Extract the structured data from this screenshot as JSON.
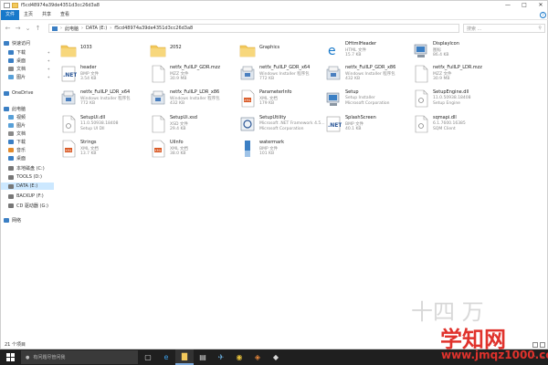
{
  "window": {
    "title": "f5cd48974a39de4351d3cc26d3a8",
    "controls": [
      "—",
      "□",
      "✕"
    ]
  },
  "ribbon": {
    "tabs": [
      "文件",
      "主页",
      "共享",
      "查看"
    ]
  },
  "address": {
    "path": [
      "此电脑",
      "DATA (E:)",
      "f5cd48974a39de4351d3cc26d3a8"
    ],
    "search_placeholder": "搜索 ..."
  },
  "sidebar": {
    "items": [
      {
        "label": "快速访问",
        "icon": "star-icon",
        "pinned": false
      },
      {
        "label": "下载",
        "icon": "download-icon",
        "pinned": true
      },
      {
        "label": "桌面",
        "icon": "desktop-icon",
        "pinned": true
      },
      {
        "label": "文档",
        "icon": "document-icon",
        "pinned": true
      },
      {
        "label": "图片",
        "icon": "picture-icon",
        "pinned": true
      },
      {
        "label": "OneDrive",
        "icon": "cloud-icon",
        "pinned": false
      },
      {
        "label": "此电脑",
        "icon": "computer-icon",
        "pinned": false
      },
      {
        "label": "视频",
        "icon": "video-icon",
        "pinned": false
      },
      {
        "label": "图片",
        "icon": "picture-icon",
        "pinned": false
      },
      {
        "label": "文档",
        "icon": "document-icon",
        "pinned": false
      },
      {
        "label": "下载",
        "icon": "download-icon",
        "pinned": false
      },
      {
        "label": "音乐",
        "icon": "music-icon",
        "pinned": false
      },
      {
        "label": "桌面",
        "icon": "desktop-icon",
        "pinned": false
      },
      {
        "label": "本地磁盘 (C:)",
        "icon": "drive-icon",
        "pinned": false
      },
      {
        "label": "TOOLS (D:)",
        "icon": "drive-icon",
        "pinned": false
      },
      {
        "label": "DATA (E:)",
        "icon": "drive-icon",
        "pinned": false,
        "selected": true
      },
      {
        "label": "BACKUP (F:)",
        "icon": "drive-icon",
        "pinned": false
      },
      {
        "label": "CD 驱动器 (G:)",
        "icon": "cd-drive-icon",
        "pinned": false
      },
      {
        "label": "网络",
        "icon": "network-icon",
        "pinned": false
      }
    ]
  },
  "files": [
    {
      "name": "1033",
      "type": "",
      "size": "",
      "icon": "folder-icon"
    },
    {
      "name": "2052",
      "type": "",
      "size": "",
      "icon": "folder-icon"
    },
    {
      "name": "Graphics",
      "type": "",
      "size": "",
      "icon": "folder-icon"
    },
    {
      "name": "DHtmlHeader",
      "type": "HTML 文件",
      "size": "15.7 KB",
      "icon": "html-icon"
    },
    {
      "name": "DisplayIcon",
      "type": "图标",
      "size": "86.4 KB",
      "icon": "setup-icon"
    },
    {
      "name": "header",
      "type": "BMP 文件",
      "size": "3.54 KB",
      "icon": "dotnet-icon"
    },
    {
      "name": "netfx_FullLP_GDR.mzz",
      "type": "MZZ 文件",
      "size": "30.9 MB",
      "icon": "blank-file-icon"
    },
    {
      "name": "netfx_FullLP_GDR_x64",
      "type": "Windows Installer 程序包",
      "size": "772 KB",
      "icon": "installer-icon"
    },
    {
      "name": "netfx_FullLP_GDR_x86",
      "type": "Windows Installer 程序包",
      "size": "432 KB",
      "icon": "installer-icon"
    },
    {
      "name": "netfx_FullLP_LDR.mzz",
      "type": "MZZ 文件",
      "size": "30.9 MB",
      "icon": "blank-file-icon"
    },
    {
      "name": "netfx_FullLP_LDR_x64",
      "type": "Windows Installer 程序包",
      "size": "772 KB",
      "icon": "installer-icon"
    },
    {
      "name": "netfx_FullLP_LDR_x86",
      "type": "Windows Installer 程序包",
      "size": "432 KB",
      "icon": "installer-icon"
    },
    {
      "name": "ParameterInfo",
      "type": "XML 文档",
      "size": "179 KB",
      "icon": "xml-icon"
    },
    {
      "name": "Setup",
      "type": "Setup Installer",
      "size": "Microsoft Corporation",
      "icon": "setup-icon"
    },
    {
      "name": "SetupEngine.dll",
      "type": "11.0.50938.18408",
      "size": "Setup Engine",
      "icon": "dll-icon"
    },
    {
      "name": "SetupUi.dll",
      "type": "11.0.50938.18408",
      "size": "Setup UI Dll",
      "icon": "dll-icon"
    },
    {
      "name": "SetupUi.xsd",
      "type": "XSD 文件",
      "size": "29.4 KB",
      "icon": "blank-file-icon"
    },
    {
      "name": "SetupUtility",
      "type": "Microsoft .NET Framework 4.5...",
      "size": "Microsoft Corporation",
      "icon": "utility-icon"
    },
    {
      "name": "SplashScreen",
      "type": "BMP 文件",
      "size": "40.1 KB",
      "icon": "dotnet-icon"
    },
    {
      "name": "sqmapi.dll",
      "type": "6.1.7600.16385",
      "size": "SQM Client",
      "icon": "dll-icon"
    },
    {
      "name": "Strings",
      "type": "XML 文档",
      "size": "13.7 KB",
      "icon": "xml-icon"
    },
    {
      "name": "UiInfo",
      "type": "XML 文档",
      "size": "38.0 KB",
      "icon": "xml-icon"
    },
    {
      "name": "watermark",
      "type": "BMP 文件",
      "size": "101 KB",
      "icon": "watermark-icon"
    }
  ],
  "status": {
    "count": "21 个项目"
  },
  "taskbar": {
    "search_placeholder": "有问题尽管问我",
    "icons": [
      "task-view-icon",
      "edge-icon",
      "file-explorer-icon",
      "store-icon",
      "bird-icon",
      "chrome-icon",
      "app-icon",
      "app2-icon"
    ]
  },
  "watermark": {
    "text": "学知网",
    "url": "www.jmqz1000.com",
    "faint": "十四 万"
  },
  "colors": {
    "accent": "#1979ca",
    "selected_bg": "#cce8ff",
    "folder": "#f3c95c",
    "taskbar": "#1f1f1f",
    "watermark": "#e0322c"
  }
}
